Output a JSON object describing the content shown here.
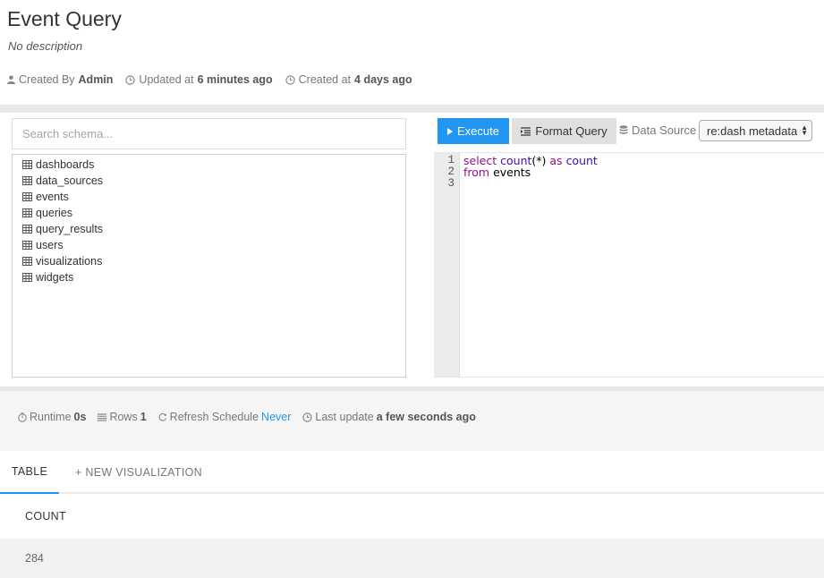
{
  "query": {
    "title": "Event Query",
    "description": "No description",
    "created_by_label": "Created By",
    "created_by": "Admin",
    "updated_label": "Updated at",
    "updated_at": "6 minutes ago",
    "created_label": "Created at",
    "created_at": "4 days ago"
  },
  "schema": {
    "search_placeholder": "Search schema...",
    "tables": [
      "dashboards",
      "data_sources",
      "events",
      "queries",
      "query_results",
      "users",
      "visualizations",
      "widgets"
    ]
  },
  "toolbar": {
    "execute_label": "Execute",
    "format_label": "Format Query",
    "datasource_label": "Data Source",
    "datasource_value": "re:dash metadata"
  },
  "editor": {
    "line_numbers": [
      "1",
      "2",
      "3"
    ]
  },
  "results": {
    "runtime_label": "Runtime",
    "runtime_value": "0s",
    "rows_label": "Rows",
    "rows_value": "1",
    "refresh_label": "Refresh Schedule",
    "refresh_value": "Never",
    "last_update_label": "Last update",
    "last_update_value": "a few seconds ago",
    "tab_table": "TABLE",
    "tab_new_viz": "+ NEW VISUALIZATION",
    "column_header": "COUNT",
    "cell_value": "284"
  },
  "colors": {
    "accent": "#2196f3",
    "keyword": "#930f80",
    "function": "#3d10b0"
  }
}
